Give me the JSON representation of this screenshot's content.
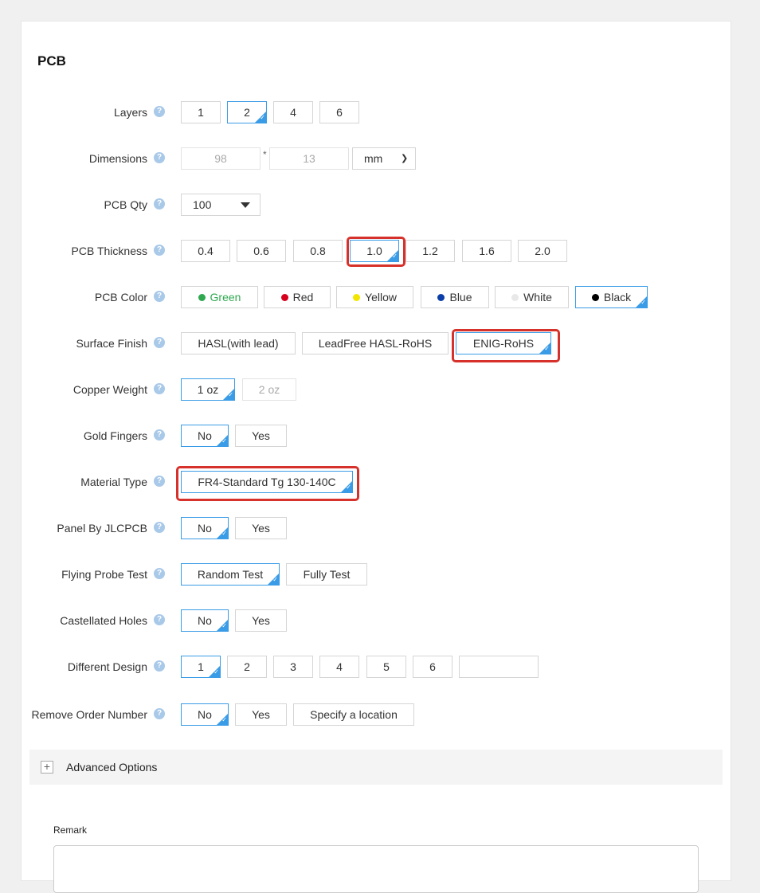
{
  "section_title": "PCB",
  "help_glyph": "?",
  "layers": {
    "label": "Layers",
    "options": [
      "1",
      "2",
      "4",
      "6"
    ],
    "selected": "2"
  },
  "dimensions": {
    "label": "Dimensions",
    "width_placeholder": "98",
    "height_placeholder": "13",
    "separator": "*",
    "unit": "mm"
  },
  "pcb_qty": {
    "label": "PCB Qty",
    "value": "100"
  },
  "thickness": {
    "label": "PCB Thickness",
    "options": [
      "0.4",
      "0.6",
      "0.8",
      "1.0",
      "1.2",
      "1.6",
      "2.0"
    ],
    "selected": "1.0"
  },
  "color": {
    "label": "PCB Color",
    "options": [
      {
        "name": "Green",
        "hex": "#2fa84f"
      },
      {
        "name": "Red",
        "hex": "#d6001c"
      },
      {
        "name": "Yellow",
        "hex": "#f2e600"
      },
      {
        "name": "Blue",
        "hex": "#0b3ea8"
      },
      {
        "name": "White",
        "hex": "#e8e8e8"
      },
      {
        "name": "Black",
        "hex": "#000000"
      }
    ],
    "selected": "Black"
  },
  "surface_finish": {
    "label": "Surface Finish",
    "options": [
      "HASL(with lead)",
      "LeadFree HASL-RoHS",
      "ENIG-RoHS"
    ],
    "selected": "ENIG-RoHS"
  },
  "copper_weight": {
    "label": "Copper Weight",
    "options": [
      "1 oz",
      "2 oz"
    ],
    "selected": "1 oz"
  },
  "gold_fingers": {
    "label": "Gold Fingers",
    "options": [
      "No",
      "Yes"
    ],
    "selected": "No"
  },
  "material_type": {
    "label": "Material Type",
    "options": [
      "FR4-Standard Tg 130-140C"
    ],
    "selected": "FR4-Standard Tg 130-140C"
  },
  "panel": {
    "label": "Panel By JLCPCB",
    "options": [
      "No",
      "Yes"
    ],
    "selected": "No"
  },
  "flying_probe": {
    "label": "Flying Probe Test",
    "options": [
      "Random Test",
      "Fully Test"
    ],
    "selected": "Random Test"
  },
  "castellated": {
    "label": "Castellated Holes",
    "options": [
      "No",
      "Yes"
    ],
    "selected": "No"
  },
  "different_design": {
    "label": "Different Design",
    "options": [
      "1",
      "2",
      "3",
      "4",
      "5",
      "6"
    ],
    "selected": "1",
    "custom_value": ""
  },
  "remove_order": {
    "label": "Remove Order Number",
    "options": [
      "No",
      "Yes",
      "Specify a location"
    ],
    "selected": "No"
  },
  "advanced": {
    "label": "Advanced Options",
    "toggle": "+"
  },
  "remark": {
    "label": "Remark",
    "value": ""
  },
  "colors": {
    "accent": "#3a9ce6",
    "highlight": "#d6322b",
    "help_icon": "#a9c9e9"
  }
}
